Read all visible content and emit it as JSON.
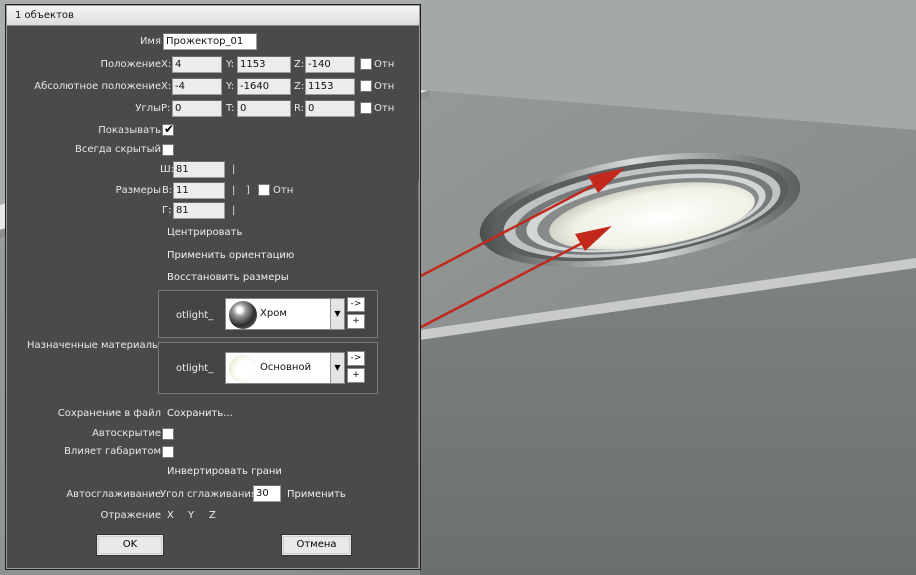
{
  "window": {
    "title": "1 объектов"
  },
  "fields": {
    "name_label": "Имя",
    "name_value": "Прожектор_01",
    "position_label": "Положение",
    "abs_position_label": "Абсолютное положение",
    "angles_label": "Углы",
    "otn_label": "Отн",
    "axis_x": "X:",
    "axis_y": "Y:",
    "axis_z": "Z:",
    "axis_p": "P:",
    "axis_t": "T:",
    "axis_r": "R:",
    "pos_x": "4",
    "pos_y": "1153",
    "pos_z": "-140",
    "abs_x": "-4",
    "abs_y": "-1640",
    "abs_z": "1153",
    "ang_p": "0",
    "ang_t": "0",
    "ang_r": "0",
    "show_label": "Показывать",
    "always_hidden_label": "Всегда скрытый",
    "size_label": "Размеры",
    "size_w_label": "Ш:",
    "size_h_label": "В:",
    "size_d_label": "Г:",
    "size_w": "81",
    "size_h": "11",
    "size_d": "81",
    "bar_glyph": "|",
    "bracket_glyph": "]",
    "center_link": "Центрировать",
    "apply_orient_link": "Применить ориентацию",
    "restore_sizes_link": "Восстановить размеры",
    "materials_label": "Назначенные материалы:",
    "save_to_file_label": "Сохранение в файл",
    "save_link": "Сохранить...",
    "autohide_label": "Автоскрытие",
    "affects_dims_label": "Влияет габаритом",
    "invert_faces_link": "Инвертировать грани",
    "autosmooth_label": "Автосглаживание",
    "smooth_angle_label": "Угол сглаживания",
    "smooth_angle_value": "30",
    "apply_link": "Применить",
    "mirror_label": "Отражение",
    "mirror_x": "X",
    "mirror_y": "Y",
    "mirror_z": "Z"
  },
  "materials": [
    {
      "slot": "otlight_",
      "name": "Хром",
      "swatch": "chrome-sphere-icon"
    },
    {
      "slot": "otlight_",
      "name": "Основной",
      "swatch": "white-sphere-icon"
    }
  ],
  "material_buttons": {
    "arrow": "->",
    "plus": "+"
  },
  "buttons": {
    "ok": "OK",
    "cancel": "Отмена"
  },
  "colors": {
    "dialog_bg": "#4a4a4a",
    "arrow_color": "#c0291c"
  }
}
